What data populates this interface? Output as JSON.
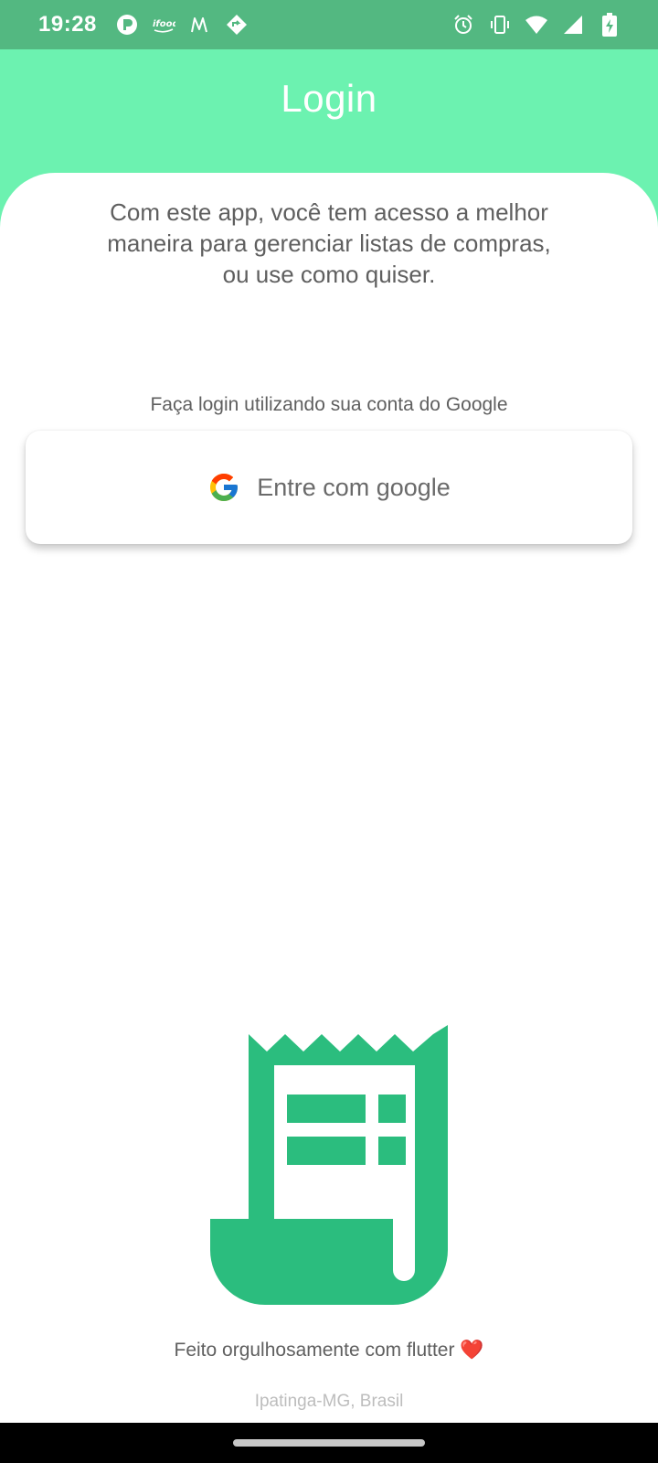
{
  "status_bar": {
    "time": "19:28",
    "notification_icons": [
      "picpay-icon",
      "ifood-icon",
      "medium-icon",
      "navigation-icon"
    ],
    "system_icons": [
      "alarm-icon",
      "vibrate-icon",
      "wifi-icon",
      "signal-icon",
      "battery-charging-icon"
    ]
  },
  "app_bar": {
    "title": "Login"
  },
  "intro": {
    "text": "Com este app, você  tem acesso a melhor\nmaneira  para gerenciar listas de compras,\nou use como quiser."
  },
  "login": {
    "hint": "Faça login utilizando sua conta do Google",
    "button_label": "Entre com google",
    "button_icon": "google-icon"
  },
  "illustration": {
    "icon": "receipt-icon"
  },
  "footer": {
    "credit": "Feito orgulhosamente com flutter",
    "heart": "❤️",
    "location": "Ipatinga-MG, Brasil"
  },
  "colors": {
    "status_bar": "#53b881",
    "app_bar": "#6cf2b0",
    "accent": "#2bbd7e",
    "text_primary": "#5f5f5f",
    "text_muted": "#bdbdbd"
  }
}
